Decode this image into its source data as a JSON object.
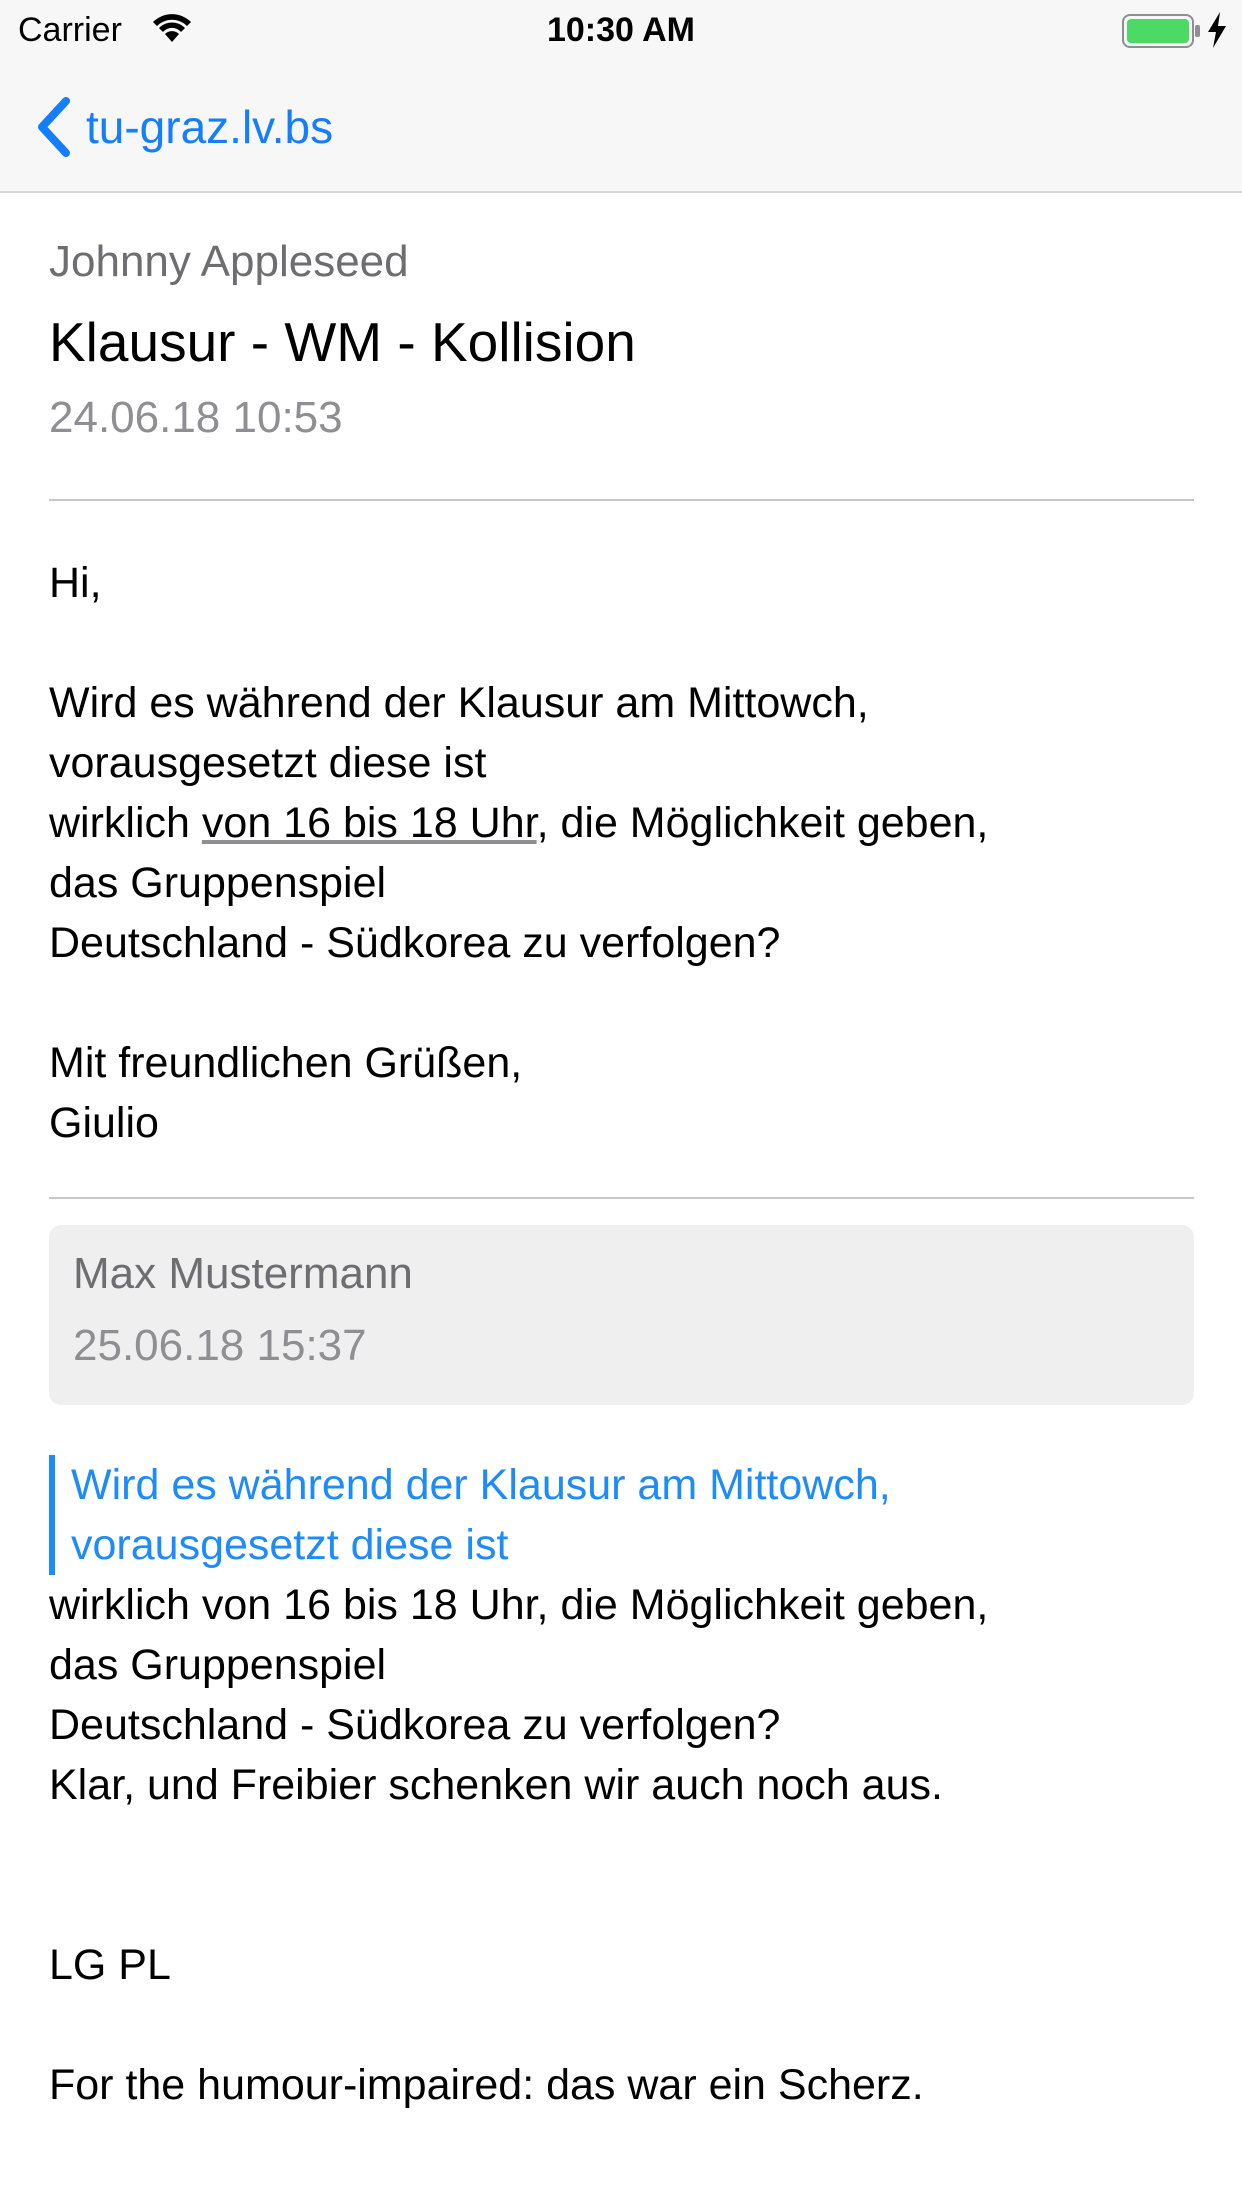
{
  "status_bar": {
    "carrier": "Carrier",
    "time": "10:30 AM",
    "battery_color": "#4cd964"
  },
  "nav": {
    "back_label": "tu-graz.lv.bs",
    "accent_color": "#147efb"
  },
  "message": {
    "author": "Johnny Appleseed",
    "subject": "Klausur - WM - Kollision",
    "date": "24.06.18 10:53",
    "body": {
      "greeting": "Hi,",
      "line1": "Wird es während der Klausur am Mittowch,",
      "line2": "vorausgesetzt diese ist",
      "line3_prefix": "wirklich ",
      "line3_link": "von 16 bis 18 Uhr",
      "line3_suffix": ", die Möglichkeit geben,",
      "line4": "das Gruppenspiel",
      "line5": "Deutschland - Südkorea zu verfolgen?",
      "closing": "Mit freundlichen Grüßen,",
      "signature": "Giulio"
    }
  },
  "reply": {
    "author": "Max Mustermann",
    "date": "25.06.18 15:37",
    "quote": {
      "line1": " Wird es während der Klausur am Mittowch,",
      "line2": "vorausgesetzt diese ist"
    },
    "body": {
      "line1": "wirklich von 16 bis 18 Uhr, die Möglichkeit geben,",
      "line2": "das Gruppenspiel",
      "line3": "Deutschland - Südkorea zu verfolgen?",
      "line4": "Klar, und Freibier schenken wir auch noch aus.",
      "signoff": "LG PL",
      "footnote": "For the humour-impaired: das war ein Scherz."
    }
  }
}
